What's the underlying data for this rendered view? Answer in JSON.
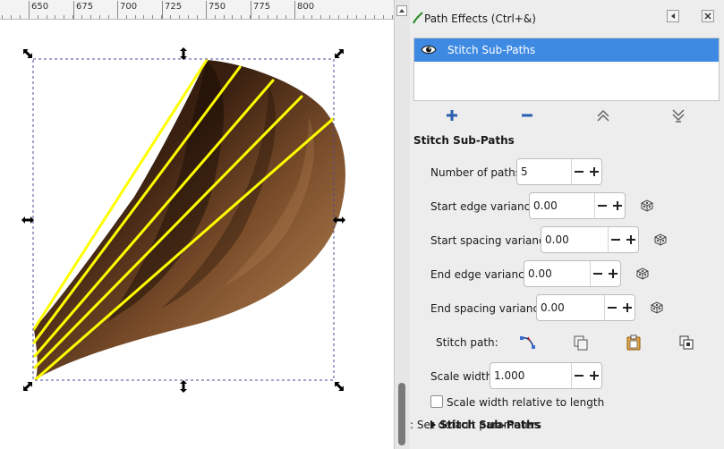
{
  "ruler": {
    "labels": [
      "650",
      "675",
      "700",
      "725",
      "750",
      "775",
      "800"
    ]
  },
  "panel": {
    "title": "Path Effects (Ctrl+&)",
    "effects": [
      {
        "label": "Stitch Sub-Paths",
        "visible": true,
        "selected": true
      }
    ],
    "list_buttons": [
      "add-effect",
      "remove-effect",
      "move-up",
      "move-down"
    ],
    "section_title": "Stitch Sub-Paths",
    "params": {
      "num_paths": {
        "label": "Number of paths:",
        "value": "5"
      },
      "start_edge": {
        "label": "Start edge variance:",
        "value": "0.00"
      },
      "start_spacing": {
        "label": "Start spacing variance:",
        "value": "0.00"
      },
      "end_edge": {
        "label": "End edge variance:",
        "value": "0.00"
      },
      "end_spacing": {
        "label": "End spacing variance:",
        "value": "0.00"
      },
      "stitch_path": {
        "label": "Stitch path:"
      },
      "scale_width": {
        "label": "Scale width:",
        "value": "1.000"
      }
    },
    "checkbox": {
      "label": "Scale width relative to length",
      "checked": false
    },
    "expander": {
      "bold": "Stitch Sub-Paths",
      "rest": ": Set default parameters"
    }
  },
  "colors": {
    "selection": "#3e8ae2",
    "stitch_lines": "#ffff00",
    "fabric_dark": "#2a170b",
    "fabric_light": "#8a5a33"
  }
}
